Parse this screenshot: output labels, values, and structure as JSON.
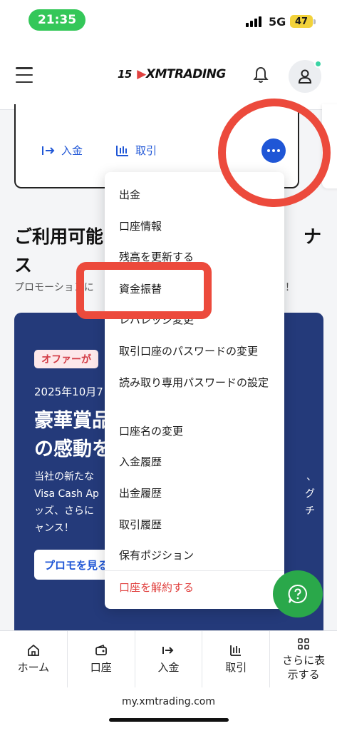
{
  "status_bar": {
    "time": "21:35",
    "network": "5G",
    "battery": "47"
  },
  "header": {
    "logo_badge": "15",
    "logo_text": "XMTRADING",
    "icons": [
      "menu-icon",
      "bell-icon",
      "user-icon"
    ]
  },
  "account_card": {
    "deposit_label": "入金",
    "trade_label": "取引"
  },
  "section": {
    "title": "ご利用可能",
    "title_end": "ナ",
    "title_line2": "ス",
    "subtitle": "プロモーションに",
    "subtitle_end": "！"
  },
  "promo": {
    "badge": "オファーが",
    "date": "2025年10月7",
    "title_line1": "豪華賞品",
    "title_line2": "の感動を",
    "text_line1": "当社の新たな",
    "text_line2": "Visa Cash Ap",
    "text_line3": "ッズ、さらに",
    "text_line4": "ャンス！",
    "text_r1": "、",
    "text_r2": "グ",
    "text_r3": "チ",
    "button": "プロモを見る"
  },
  "menu": {
    "items": [
      "出金",
      "口座情報",
      "残高を更新する",
      "資金振替",
      "レバレッジ変更",
      "取引口座のパスワードの変更",
      "読み取り専用パスワードの設定",
      "口座名の変更",
      "入金履歴",
      "出金履歴",
      "取引履歴",
      "保有ポジション"
    ],
    "danger_item": "口座を解約する"
  },
  "bottom_nav": {
    "items": [
      {
        "label": "ホーム",
        "icon": "home-icon"
      },
      {
        "label": "口座",
        "icon": "wallet-icon"
      },
      {
        "label": "入金",
        "icon": "deposit-icon"
      },
      {
        "label": "取引",
        "icon": "chart-icon"
      },
      {
        "label": "さらに表示する",
        "icon": "grid-icon"
      }
    ]
  },
  "url": "my.xmtrading.com",
  "colors": {
    "accent": "#1f56d6",
    "annotation": "#ec4a3c",
    "promo_bg": "#243a7a",
    "chat": "#2aa84a",
    "danger": "#e0413f"
  }
}
